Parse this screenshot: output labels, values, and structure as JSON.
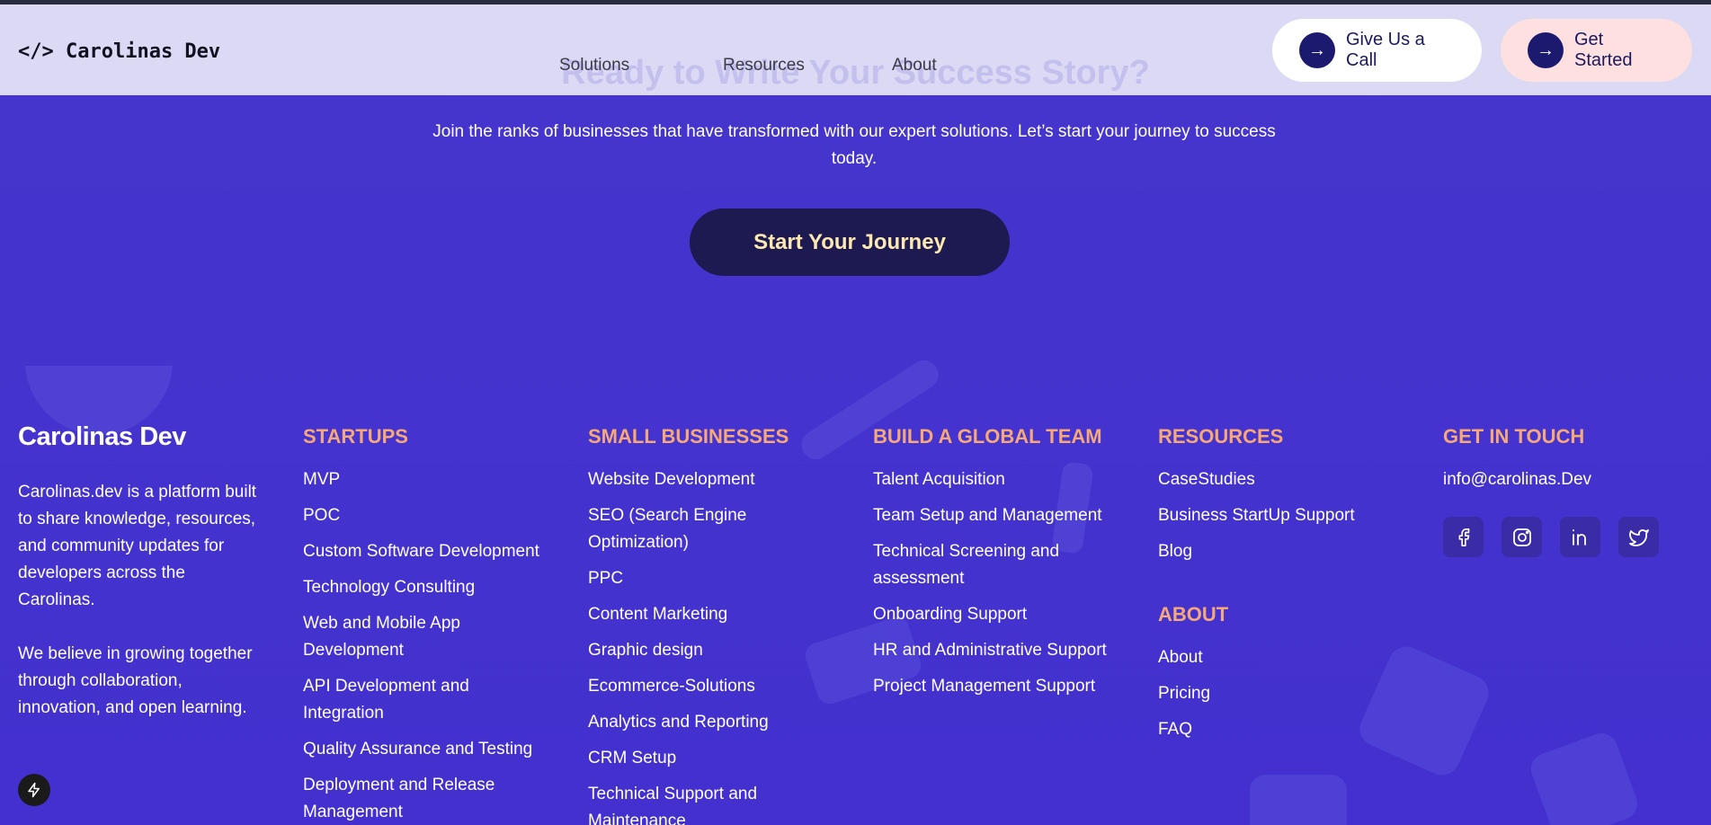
{
  "header": {
    "logo": "</> Carolinas Dev",
    "ghost_heading": "Ready to Write Your Success Story?",
    "nav": [
      "Solutions",
      "Resources",
      "About"
    ],
    "buttons": {
      "call": "Give Us a Call",
      "start": "Get Started",
      "arrow": "→"
    }
  },
  "cta": {
    "text": "Join the ranks of businesses that have transformed with our expert solutions. Let’s start your journey to success today.",
    "button": "Start Your Journey"
  },
  "footer": {
    "brand": {
      "title": "Carolinas Dev",
      "p1": "Carolinas.dev is a platform built to share knowledge, resources, and community updates for developers across the Carolinas.",
      "p2": "We believe in growing together through collaboration, innovation, and open learning."
    },
    "startups": {
      "heading": "STARTUPS",
      "items": [
        "MVP",
        "POC",
        "Custom Software Development",
        "Technology Consulting",
        "Web and Mobile App Development",
        "API Development and Integration",
        "Quality Assurance and Testing",
        "Deployment and Release Management"
      ]
    },
    "small_businesses": {
      "heading": "SMALL BUSINESSES",
      "items": [
        "Website Development",
        "SEO (Search Engine Optimization)",
        "PPC",
        "Content Marketing",
        "Graphic design",
        "Ecommerce-Solutions",
        "Analytics and Reporting",
        "CRM Setup",
        "Technical Support and Maintenance"
      ]
    },
    "global_team": {
      "heading": "BUILD A GLOBAL TEAM",
      "items": [
        "Talent Acquisition",
        "Team Setup and Management",
        "Technical Screening and assessment",
        "Onboarding Support",
        "HR and Administrative Support",
        "Project Management Support"
      ]
    },
    "resources": {
      "heading": "RESOURCES",
      "items": [
        "CaseStudies",
        "Business StartUp Support",
        "Blog"
      ]
    },
    "about": {
      "heading": "ABOUT",
      "items": [
        "About",
        "Pricing",
        "FAQ"
      ]
    },
    "contact": {
      "heading": "GET IN TOUCH",
      "email": "info@carolinas.Dev",
      "socials": [
        "facebook-icon",
        "instagram-icon",
        "linkedin-icon",
        "twitter-icon"
      ]
    }
  },
  "colors": {
    "background": "#4533cc",
    "accent_heading": "#f6a878",
    "dark_button": "#1c1a50",
    "header_bg": "#e2e0f6"
  }
}
